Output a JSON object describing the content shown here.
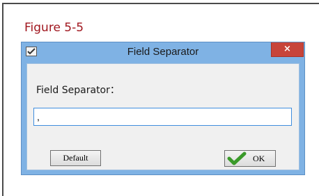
{
  "figure": {
    "caption": "Figure 5-5"
  },
  "dialog": {
    "title": "Field Separator",
    "close_glyph": "×",
    "app_icon": "checkmark-pen-icon",
    "field_label": "Field Separator：",
    "input_value": ",",
    "default_button_label": "Default",
    "ok_button_label": "OK",
    "ok_icon": "green-check-icon"
  },
  "colors": {
    "caption": "#a0161e",
    "title_bar": "#7fb2e4",
    "close_button": "#c7443a",
    "input_border": "#3f8ede",
    "check_green": "#3a9a2a"
  }
}
